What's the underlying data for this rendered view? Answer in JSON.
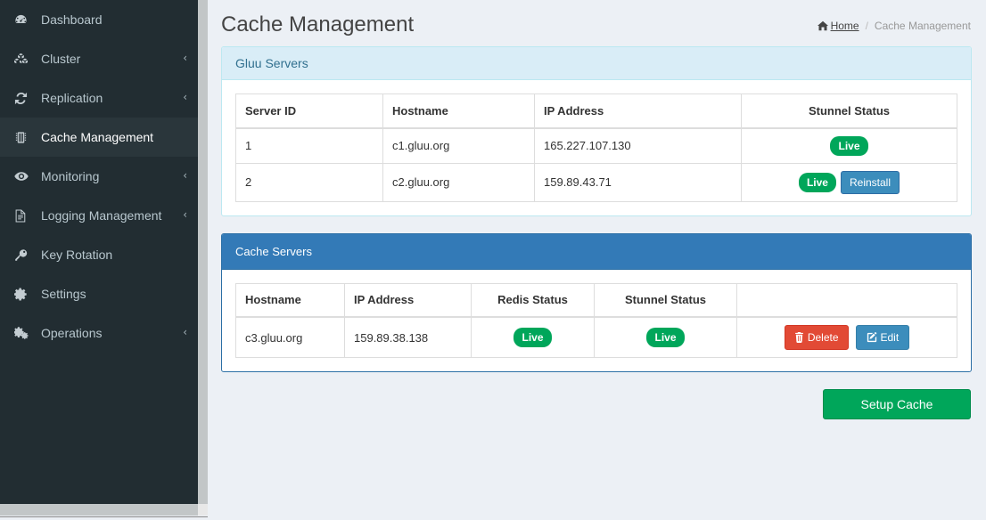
{
  "sidebar": {
    "items": [
      {
        "label": "Dashboard",
        "icon": "dashboard-icon",
        "caret": false,
        "active": false
      },
      {
        "label": "Cluster",
        "icon": "cubes-icon",
        "caret": true,
        "active": false
      },
      {
        "label": "Replication",
        "icon": "refresh-icon",
        "caret": true,
        "active": false
      },
      {
        "label": "Cache Management",
        "icon": "memory-chip-icon",
        "caret": false,
        "active": true
      },
      {
        "label": "Monitoring",
        "icon": "eye-icon",
        "caret": true,
        "active": false
      },
      {
        "label": "Logging Management",
        "icon": "file-text-icon",
        "caret": true,
        "active": false
      },
      {
        "label": "Key Rotation",
        "icon": "key-icon",
        "caret": false,
        "active": false
      },
      {
        "label": "Settings",
        "icon": "gear-icon",
        "caret": false,
        "active": false
      },
      {
        "label": "Operations",
        "icon": "cogs-icon",
        "caret": true,
        "active": false
      }
    ],
    "caret_glyph": "‹"
  },
  "header": {
    "title": "Cache Management",
    "breadcrumb": {
      "home_label": "Home",
      "home_icon": "home-icon",
      "separator": "/",
      "current": "Cache Management"
    }
  },
  "panels": {
    "gluu_servers": {
      "title": "Gluu Servers",
      "columns": [
        "Server ID",
        "Hostname",
        "IP Address",
        "Stunnel Status"
      ],
      "rows": [
        {
          "server_id": "1",
          "hostname": "c1.gluu.org",
          "ip_address": "165.227.107.130",
          "stunnel_status": "Live",
          "reinstall_label": null
        },
        {
          "server_id": "2",
          "hostname": "c2.gluu.org",
          "ip_address": "159.89.43.71",
          "stunnel_status": "Live",
          "reinstall_label": "Reinstall"
        }
      ]
    },
    "cache_servers": {
      "title": "Cache Servers",
      "columns": [
        "Hostname",
        "IP Address",
        "Redis Status",
        "Stunnel Status",
        ""
      ],
      "rows": [
        {
          "hostname": "c3.gluu.org",
          "ip_address": "159.89.38.138",
          "redis_status": "Live",
          "stunnel_status": "Live",
          "delete_label": "Delete",
          "edit_label": "Edit"
        }
      ]
    }
  },
  "footer": {
    "setup_cache_label": "Setup Cache"
  },
  "colors": {
    "sidebar_bg": "#222d32",
    "content_bg": "#ecf0f5",
    "panel_info_header": "#d9edf7",
    "panel_info_text": "#31708f",
    "panel_primary_header": "#337ab7",
    "badge_live": "#00a65a",
    "btn_delete": "#e24a35",
    "btn_edit": "#3c8dbc",
    "btn_setup": "#00a65a",
    "link": "#3c8dbc"
  }
}
